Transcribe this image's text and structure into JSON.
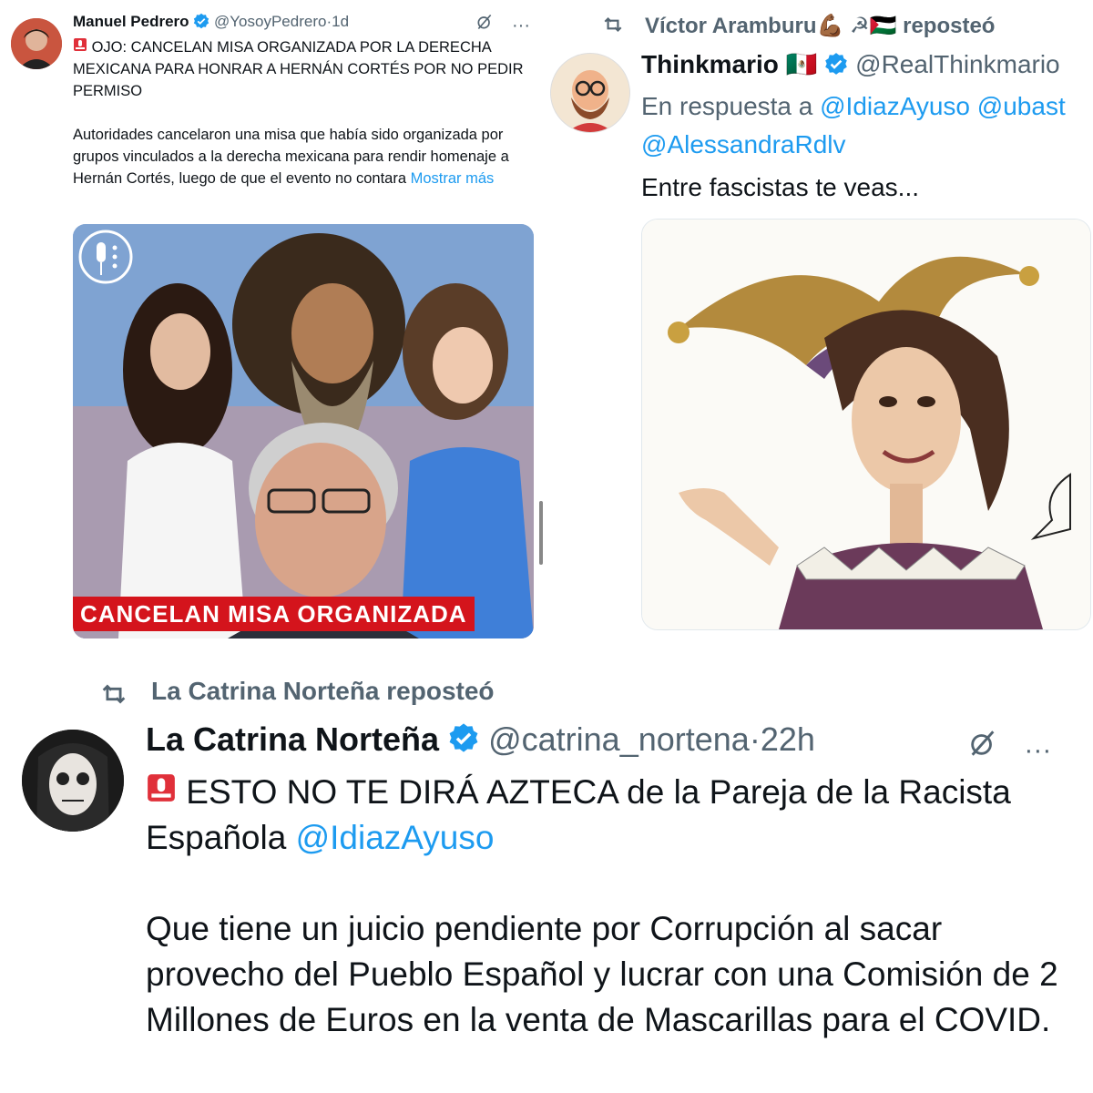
{
  "panel1": {
    "author_name": "Manuel Pedrero",
    "author_handle": "@YosoyPedrero",
    "separator": "·",
    "timestamp": "1d",
    "headline": "OJO: CANCELAN MISA ORGANIZADA POR LA DERECHA MEXICANA PARA HONRAR A HERNÁN CORTÉS POR NO PEDIR PERMISO",
    "body": "Autoridades cancelaron una misa que había sido organizada por grupos vinculados a la derecha mexicana para rendir homenaje a Hernán Cortés, luego de que el evento no contara",
    "show_more": "Mostrar más",
    "image_banner": "CANCELAN MISA ORGANIZADA",
    "more_icon": "more-icon",
    "grok_icon": "grok-icon"
  },
  "panel2": {
    "repost_by": "Víctor Aramburu",
    "repost_emojis": "💪🏾 ☭🇵🇸",
    "repost_label": "reposteó",
    "author_name": "Thinkmario",
    "author_flag": "🇲🇽",
    "author_handle": "@RealThinkmario",
    "reply_prefix": "En respuesta a",
    "reply_handle_1": "@IdiazAyuso",
    "reply_handle_2": "@ubast",
    "reply_handle_3": "@AlessandraRdlv",
    "body": "Entre fascistas te veas..."
  },
  "panel3": {
    "repost_by": "La Catrina Norteña",
    "repost_label": "reposteó",
    "author_name": "La Catrina Norteña",
    "author_handle": "@catrina_nortena",
    "separator": "·",
    "timestamp": "22h",
    "line1": "ESTO NO TE DIRÁ AZTECA de la Pareja de la Racista Española",
    "mention": "@IdiazAyuso",
    "body": "Que tiene un juicio pendiente por Corrupción al sacar provecho del Pueblo Español y lucrar con una Comisión de 2 Millones de Euros en la venta de Mascarillas para el COVID."
  },
  "colors": {
    "link": "#1d9bf0",
    "secondary_text": "#536471",
    "banner_red": "#d4141c",
    "verified_blue": "#1d9bf0"
  }
}
